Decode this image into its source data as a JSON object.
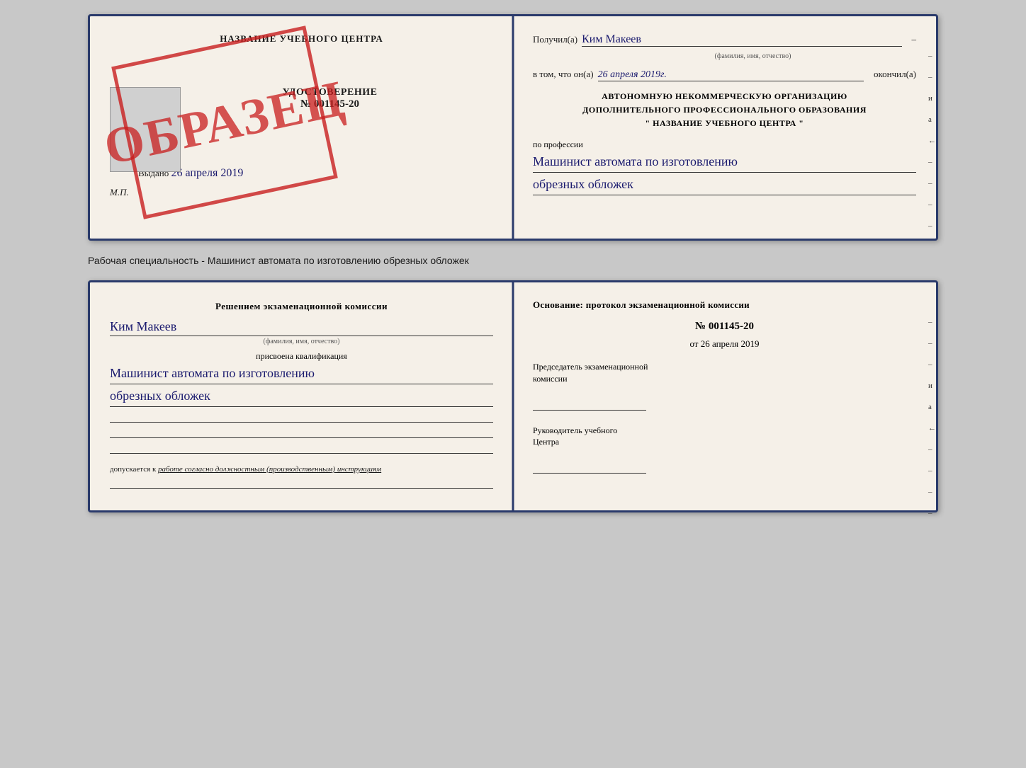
{
  "page": {
    "background": "#c8c8c8"
  },
  "spread1": {
    "left": {
      "training_center_title": "НАЗВАНИЕ УЧЕБНОГО ЦЕНТРА",
      "doc_type": "УДОСТОВЕРЕНИЕ",
      "doc_number": "№ 001145-20",
      "issued_label": "Выдано",
      "issued_date": "26 апреля 2019",
      "mp_label": "М.П.",
      "stamp": "ОБРАЗЕЦ"
    },
    "right": {
      "received_label": "Получил(а)",
      "received_name": "Ким Макеев",
      "name_sub": "(фамилия, имя, отчество)",
      "dash": "–",
      "in_that_label": "в том, что он(а)",
      "date_value": "26 апреля 2019г.",
      "finished_label": "окончил(а)",
      "org_line1": "АВТОНОМНУЮ НЕКОММЕРЧЕСКУЮ ОРГАНИЗАЦИЮ",
      "org_line2": "ДОПОЛНИТЕЛЬНОГО ПРОФЕССИОНАЛЬНОГО ОБРАЗОВАНИЯ",
      "org_line3": "\"   НАЗВАНИЕ УЧЕБНОГО ЦЕНТРА   \"",
      "profession_label": "по профессии",
      "profession_line1": "Машинист автомата по изготовлению",
      "profession_line2": "обрезных обложек",
      "right_marks": [
        "–",
        "–",
        "и",
        "а",
        "←",
        "–",
        "–",
        "–",
        "–"
      ]
    }
  },
  "separator": {
    "text": "Рабочая специальность - Машинист автомата по изготовлению обрезных обложек"
  },
  "spread2": {
    "left": {
      "komissia_line1": "Решением экзаменационной комиссии",
      "name_value": "Ким Макеев",
      "name_sub": "(фамилия, имя, отчество)",
      "kvalif_label": "присвоена квалификация",
      "kvalif_line1": "Машинист автомата по изготовлению",
      "kvalif_line2": "обрезных обложек",
      "dopusk_prefix": "допускается к",
      "dopusk_text": "работе согласно должностным (производственным) инструкциям",
      "blank_lines": 3
    },
    "right": {
      "osnov_label": "Основание: протокол экзаменационной комиссии",
      "protocol_number": "№ 001145-20",
      "date_prefix": "от",
      "date_value": "26 апреля 2019",
      "chairman_line1": "Председатель экзаменационной",
      "chairman_line2": "комиссии",
      "director_line1": "Руководитель учебного",
      "director_line2": "Центра",
      "right_marks": [
        "–",
        "–",
        "–",
        "и",
        "а",
        "←",
        "–",
        "–",
        "–",
        "–"
      ]
    }
  }
}
